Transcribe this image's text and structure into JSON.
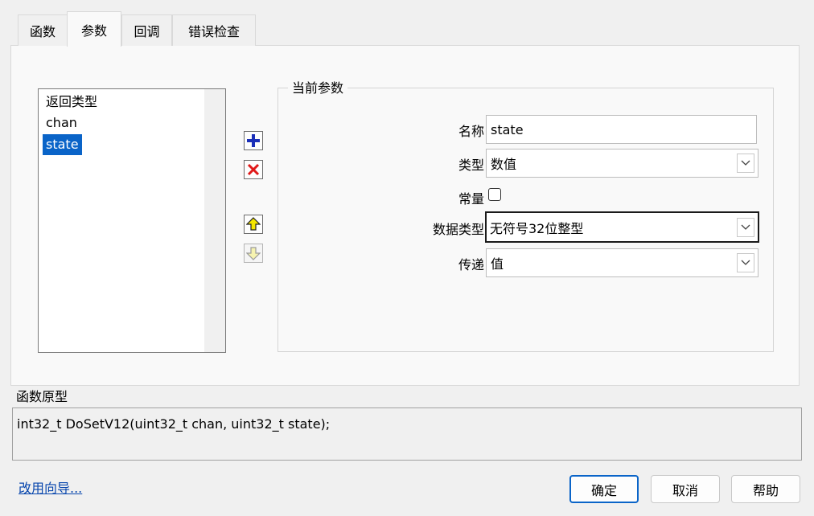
{
  "tabs": [
    {
      "label": "函数"
    },
    {
      "label": "参数"
    },
    {
      "label": "回调"
    },
    {
      "label": "错误检查"
    }
  ],
  "active_tab": "参数",
  "param_list": {
    "items": [
      "返回类型",
      "chan",
      "state"
    ],
    "selected": "state"
  },
  "current_param": {
    "group_title": "当前参数",
    "name_label": "名称",
    "name_value": "state",
    "type_label": "类型",
    "type_value": "数值",
    "const_label": "常量",
    "const_checked": false,
    "datatype_label": "数据类型",
    "datatype_value": "无符号32位整型",
    "pass_label": "传递",
    "pass_value": "值"
  },
  "prototype": {
    "label": "函数原型",
    "text": "int32_t DoSetV12(uint32_t chan, uint32_t state);"
  },
  "footer": {
    "wizard_link": "改用向导...",
    "ok": "确定",
    "cancel": "取消",
    "help": "帮助"
  },
  "colors": {
    "selection": "#0a64c8",
    "link": "#0645ad",
    "add_icon": "#1a2fb8",
    "delete_icon": "#e01818",
    "move_icon": "#f5e600"
  }
}
